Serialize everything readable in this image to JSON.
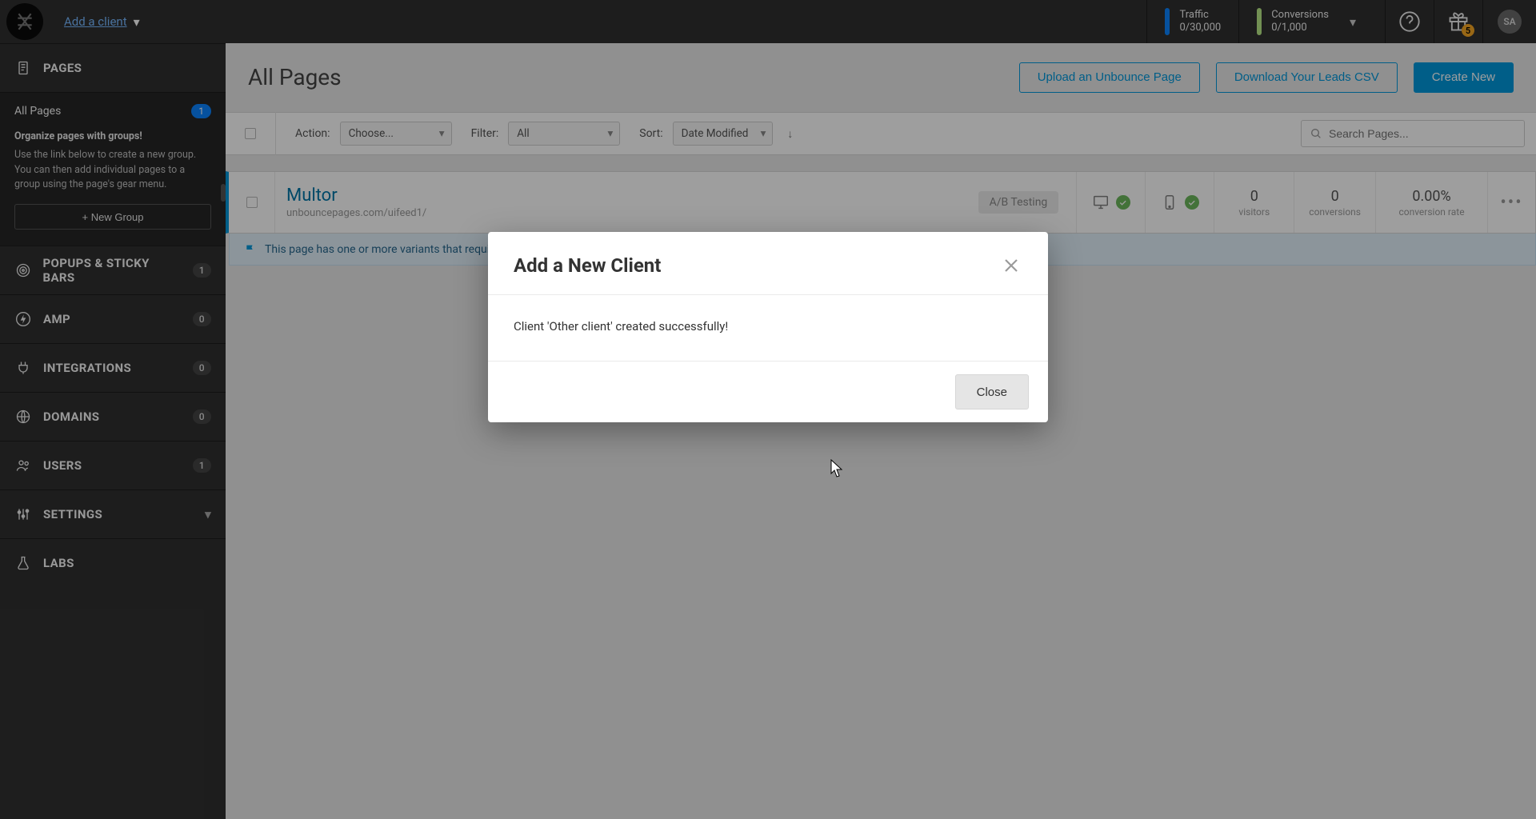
{
  "topbar": {
    "client_link": "Add a client",
    "traffic_label": "Traffic",
    "traffic_value": "0/30,000",
    "conversions_label": "Conversions",
    "conversions_value": "0/1,000",
    "gift_badge": "5",
    "avatar_initials": "SA"
  },
  "sidebar": {
    "pages_label": "PAGES",
    "all_pages_label": "All Pages",
    "all_pages_count": "1",
    "organize_title": "Organize pages with groups!",
    "organize_body": "Use the link below to create a new group. You can then add individual pages to a group using the page's gear menu.",
    "new_group_button": "+ New Group",
    "popups_label": "POPUPS & STICKY BARS",
    "popups_badge": "1",
    "amp_label": "AMP",
    "amp_badge": "0",
    "integrations_label": "INTEGRATIONS",
    "integrations_badge": "0",
    "domains_label": "DOMAINS",
    "domains_badge": "0",
    "users_label": "USERS",
    "users_badge": "1",
    "settings_label": "SETTINGS",
    "labs_label": "LABS"
  },
  "main": {
    "title": "All Pages",
    "upload_button": "Upload an Unbounce Page",
    "download_button": "Download Your Leads CSV",
    "create_button": "Create New",
    "action_label": "Action:",
    "action_value": "Choose...",
    "filter_label": "Filter:",
    "filter_value": "All",
    "sort_label": "Sort:",
    "sort_value": "Date Modified",
    "search_placeholder": "Search Pages..."
  },
  "page_row": {
    "name": "Multor",
    "url": "unbouncepages.com/uifeed1/",
    "ab_label": "A/B Testing",
    "visitors_num": "0",
    "visitors_label": "visitors",
    "conversions_num": "0",
    "conversions_label": "conversions",
    "rate_num": "0.00%",
    "rate_label": "conversion rate",
    "notice": "This page has one or more variants that require republishing."
  },
  "modal": {
    "title": "Add a New Client",
    "message": "Client 'Other client' created successfully!",
    "close_label": "Close"
  }
}
